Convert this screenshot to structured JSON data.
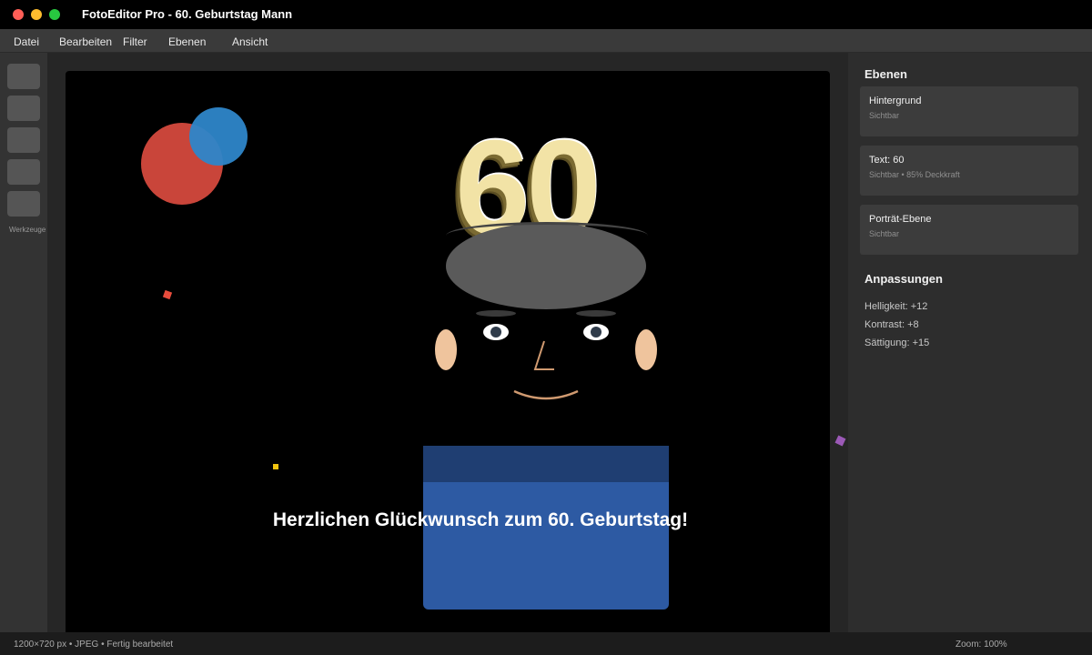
{
  "window": {
    "title": "FotoEditor Pro - 60. Geburtstag Mann"
  },
  "menu": {
    "items": [
      "Datei",
      "Bearbeiten",
      "Filter",
      "Ebenen",
      "Ansicht"
    ]
  },
  "toolbar": {
    "label": "Werkzeuge",
    "tool_count": 5
  },
  "canvas": {
    "number_text": "60",
    "greeting": "Herzlichen Glückwunsch zum 60. Geburtstag!",
    "colors": {
      "balloon_red": "#c9453a",
      "balloon_blue": "#2e86c9",
      "number_gold": "#f2e3a6",
      "shirt_blue": "#2d5aa3",
      "skin": "#efc49d"
    }
  },
  "panel": {
    "layers_heading": "Ebenen",
    "layers": [
      {
        "name": "Hintergrund",
        "status": "Sichtbar"
      },
      {
        "name": "Text: 60",
        "status": "Sichtbar • 85% Deckkraft"
      },
      {
        "name": "Porträt-Ebene",
        "status": "Sichtbar"
      }
    ],
    "adjustments_heading": "Anpassungen",
    "adjustments": [
      "Helligkeit: +12",
      "Kontrast: +8",
      "Sättigung: +15"
    ]
  },
  "status": {
    "info": "1200×720 px • JPEG • Fertig bearbeitet",
    "zoom": "Zoom: 100%"
  }
}
